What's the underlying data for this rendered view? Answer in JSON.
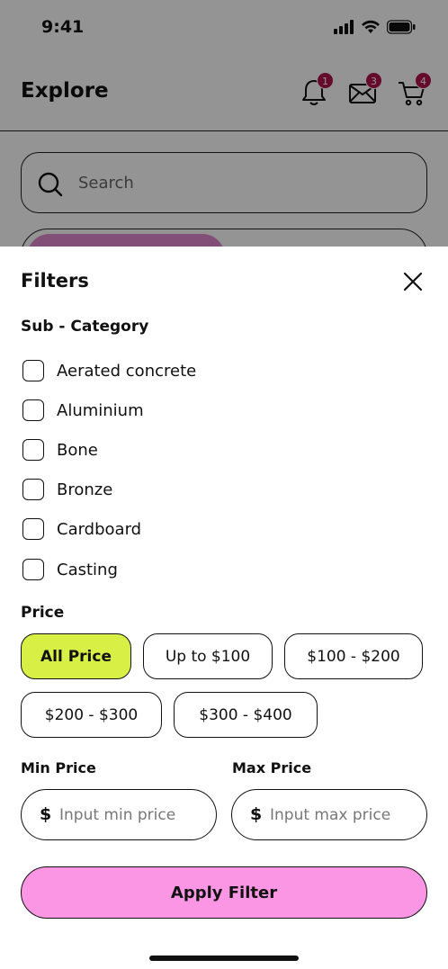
{
  "status_bar": {
    "time": "9:41"
  },
  "header": {
    "title": "Explore",
    "notifications": {
      "icon": "bell-icon",
      "count": "1"
    },
    "messages": {
      "icon": "mail-icon",
      "count": "3"
    },
    "cart": {
      "icon": "cart-icon",
      "count": "4"
    }
  },
  "search": {
    "placeholder": "Search",
    "icon": "search-icon"
  },
  "filters": {
    "title": "Filters",
    "sub_category": {
      "label": "Sub - Category",
      "items": [
        {
          "label": "Aerated concrete",
          "checked": false
        },
        {
          "label": "Aluminium",
          "checked": false
        },
        {
          "label": "Bone",
          "checked": false
        },
        {
          "label": "Bronze",
          "checked": false
        },
        {
          "label": "Cardboard",
          "checked": false
        },
        {
          "label": "Casting",
          "checked": false
        }
      ]
    },
    "price": {
      "label": "Price",
      "options": [
        {
          "label": "All Price",
          "active": true
        },
        {
          "label": "Up to $100",
          "active": false
        },
        {
          "label": "$100 - $200",
          "active": false
        },
        {
          "label": "$200 - $300",
          "active": false
        },
        {
          "label": "$300 - $400",
          "active": false
        }
      ]
    },
    "min_price": {
      "label": "Min Price",
      "currency": "$",
      "placeholder": "Input min price",
      "value": ""
    },
    "max_price": {
      "label": "Max Price",
      "currency": "$",
      "placeholder": "Input max price",
      "value": ""
    },
    "apply_label": "Apply Filter"
  },
  "colors": {
    "active_pill": "#d8f046",
    "apply_button": "#fb96e4",
    "badge": "#b0124a",
    "overlay": "rgba(0,0,0,0.42)"
  }
}
